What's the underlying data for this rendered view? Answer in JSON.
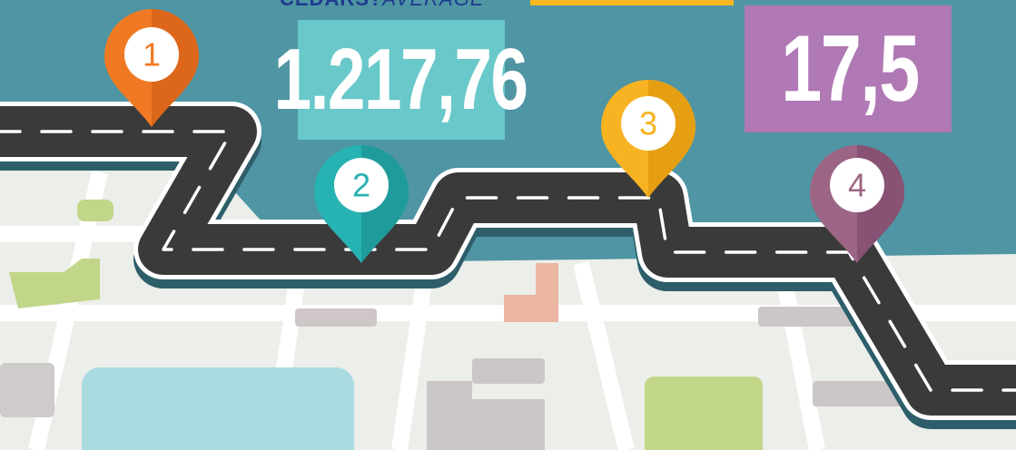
{
  "header": {
    "label_bold": "CEDARS?",
    "label_light": "AVERAGE"
  },
  "stats": [
    {
      "value": "1.217,76",
      "color": "#69c8c9"
    },
    {
      "value": "17,5",
      "color": "#b078b4"
    }
  ],
  "top_bar_color": "#f7b81f",
  "pins": [
    {
      "number": "1",
      "color": "#f07a24",
      "shade": "#d9651a"
    },
    {
      "number": "2",
      "color": "#27b2b3",
      "shade": "#1f9899"
    },
    {
      "number": "3",
      "color": "#f7b322",
      "shade": "#e39c12"
    },
    {
      "number": "4",
      "color": "#9c6585",
      "shade": "#855071"
    }
  ],
  "colors": {
    "sky": "#4f95a3",
    "map_ground": "#eceeea",
    "map_street": "#ffffff",
    "road": "#3a3a3a",
    "road_edge": "#ffffff",
    "road_shadow": "#2d5e6a"
  }
}
